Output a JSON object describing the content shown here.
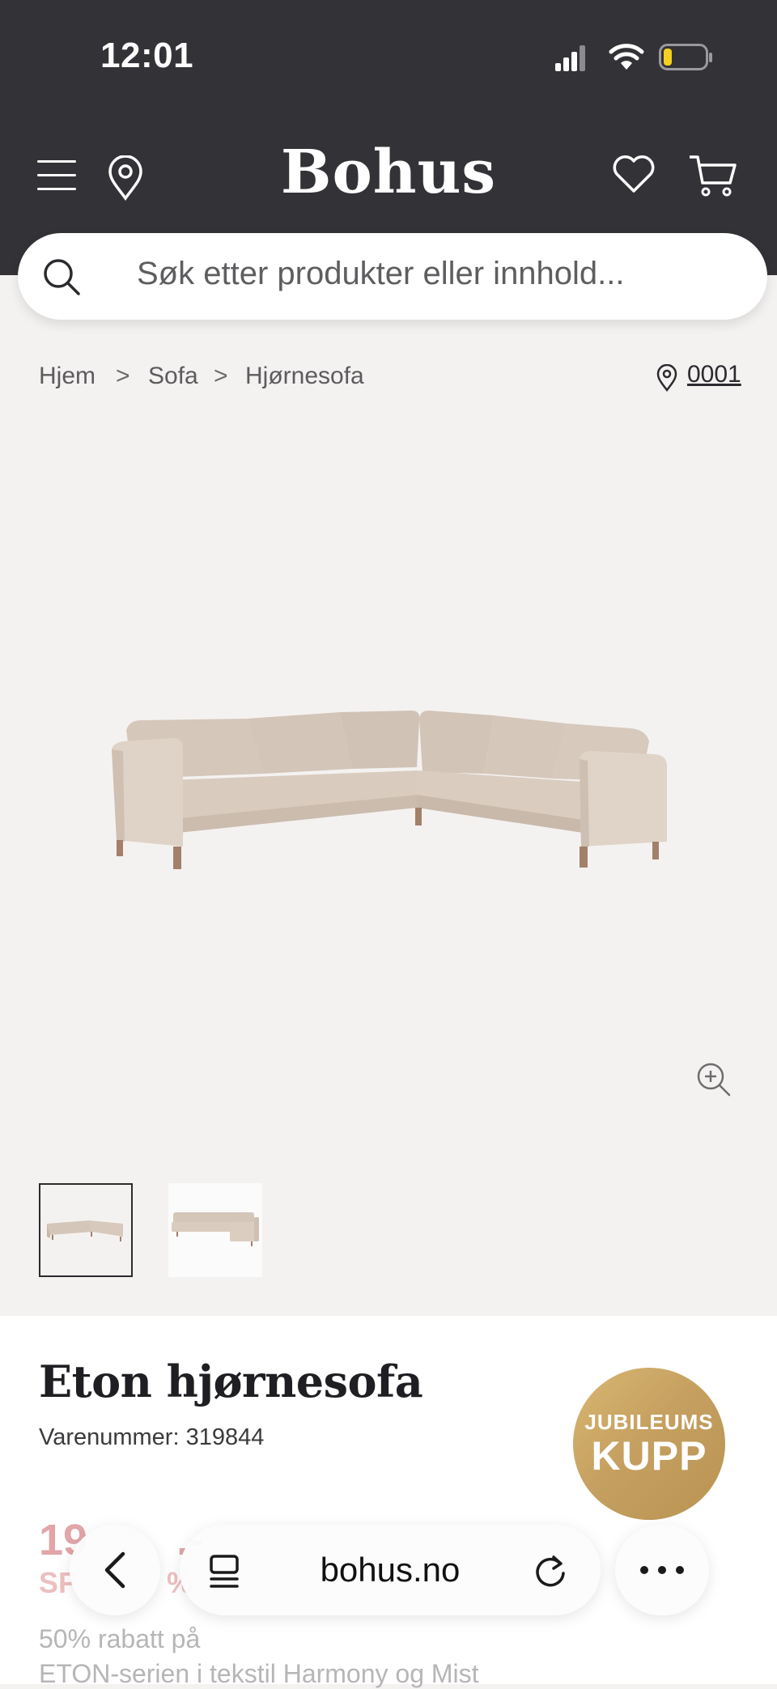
{
  "status_bar": {
    "time": "12:01"
  },
  "header": {
    "brand": "Bohus"
  },
  "search": {
    "placeholder": "Søk etter produkter eller innhold..."
  },
  "breadcrumb": {
    "items": [
      "Hjem",
      "Sofa",
      "Hjørnesofa"
    ],
    "separator": ">",
    "store_code": "0001"
  },
  "product": {
    "name": "Eton hjørnesofa",
    "sku_label": "Varenummer: 319844",
    "badge_line1": "JUBILEUMS",
    "badge_line2": "KUPP",
    "price_visible": "19",
    "price_suffix": ".-",
    "savings_visible": "SP",
    "savings_suffix": "%",
    "desc_line1": "50% rabatt på",
    "desc_line2": "ETON-serien i tekstil Harmony og Mist"
  },
  "browser": {
    "url": "bohus.no"
  },
  "colors": {
    "header_bg": "#333236",
    "page_bg": "#f4f2f1",
    "price": "#d9878b",
    "badge_gold": "#c6a060"
  },
  "icons": {
    "menu": "menu-icon",
    "location": "location-pin-icon",
    "wishlist": "heart-icon",
    "cart": "cart-icon",
    "search": "search-icon",
    "zoom": "zoom-in-icon",
    "back": "chevron-left-icon",
    "tabs": "tabs-icon",
    "reload": "reload-icon",
    "more": "more-icon"
  }
}
